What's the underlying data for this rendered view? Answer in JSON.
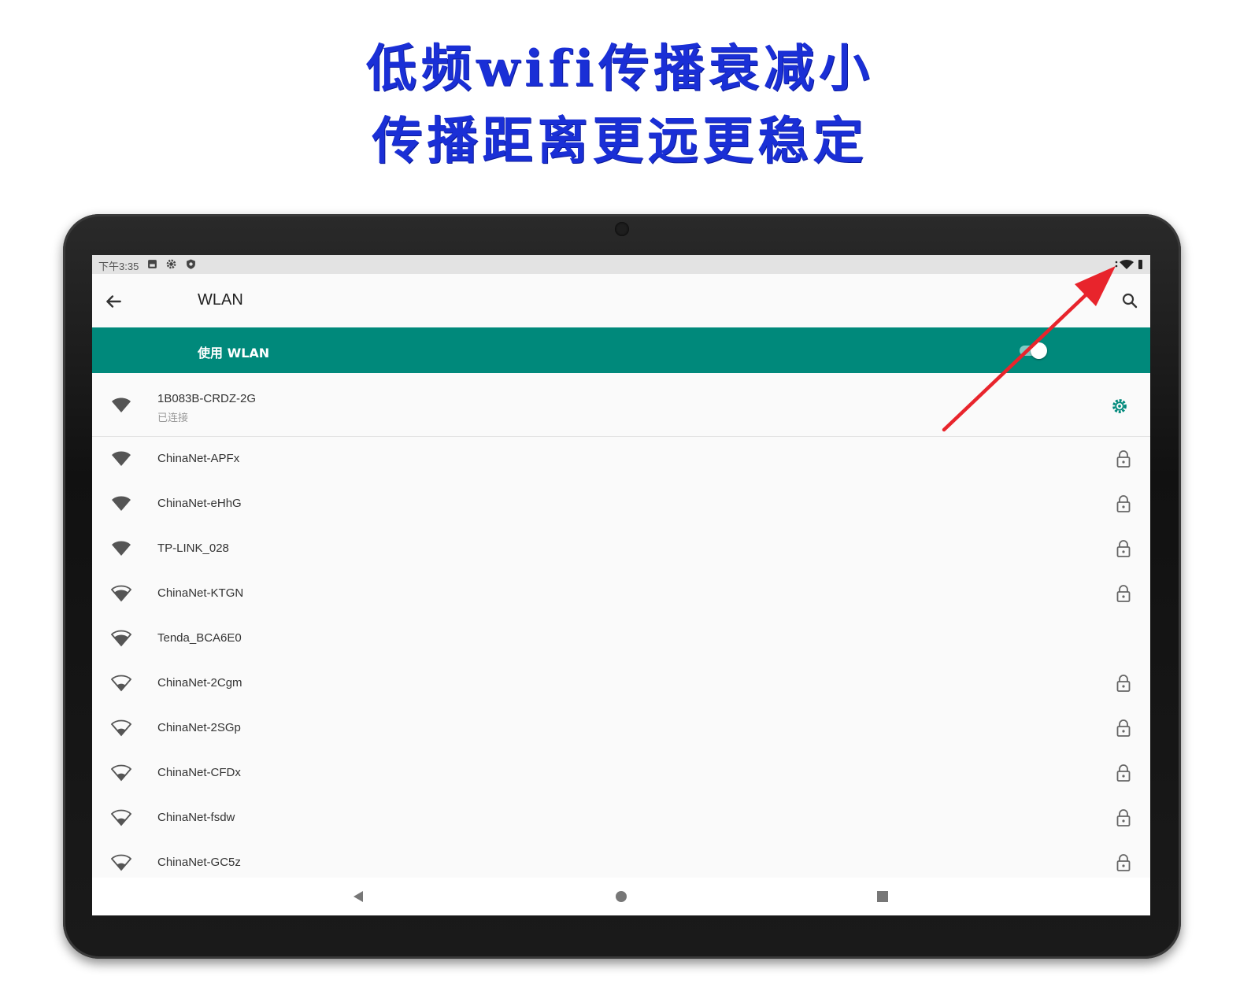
{
  "promo": {
    "line1": "低频wifi传播衰减小",
    "line2": "传播距离更远更稳定"
  },
  "status_bar": {
    "time": "下午3:35",
    "icons": [
      "image-icon",
      "gear-icon",
      "shield-icon"
    ],
    "right_icons": [
      "wifi-icon",
      "battery-icon"
    ]
  },
  "app_bar": {
    "title": "WLAN",
    "back_icon": "arrow-back-icon",
    "search_icon": "search-icon"
  },
  "wlan_toggle": {
    "label": "使用 WLAN",
    "state": "on"
  },
  "connected_network": {
    "ssid": "1B083B-CRDZ-2G",
    "status": "已连接",
    "signal_icon": "wifi-full-icon",
    "settings_icon": "gear-icon"
  },
  "networks": [
    {
      "ssid": "ChinaNet-APFx",
      "secured": true,
      "signal": "full"
    },
    {
      "ssid": "ChinaNet-eHhG",
      "secured": true,
      "signal": "full"
    },
    {
      "ssid": "TP-LINK_028",
      "secured": true,
      "signal": "full"
    },
    {
      "ssid": "ChinaNet-KTGN",
      "secured": true,
      "signal": "medium"
    },
    {
      "ssid": "Tenda_BCA6E0",
      "secured": false,
      "signal": "medium"
    },
    {
      "ssid": "ChinaNet-2Cgm",
      "secured": true,
      "signal": "low"
    },
    {
      "ssid": "ChinaNet-2SGp",
      "secured": true,
      "signal": "low"
    },
    {
      "ssid": "ChinaNet-CFDx",
      "secured": true,
      "signal": "low"
    },
    {
      "ssid": "ChinaNet-fsdw",
      "secured": true,
      "signal": "low"
    },
    {
      "ssid": "ChinaNet-GC5z",
      "secured": true,
      "signal": "low"
    }
  ],
  "nav_bar": {
    "buttons": [
      "back-triangle-icon",
      "home-circle-icon",
      "recents-square-icon"
    ]
  },
  "colors": {
    "accent": "#00897b",
    "promo_text": "#1a2fd6",
    "annotation_arrow": "#e8242c"
  }
}
